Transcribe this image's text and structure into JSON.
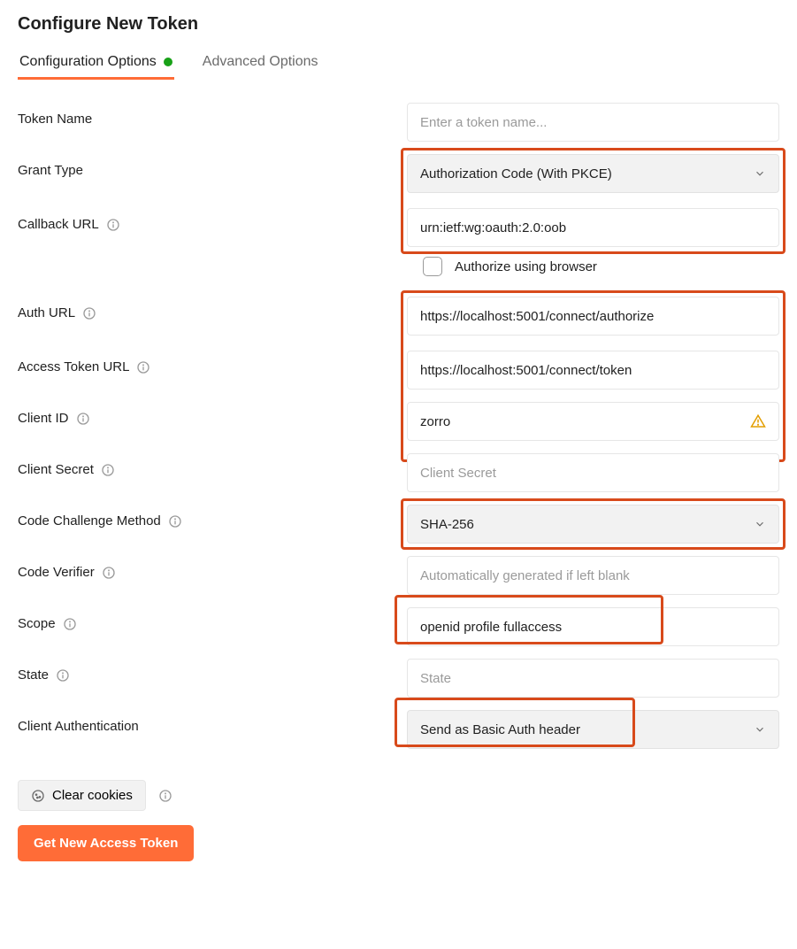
{
  "title": "Configure New Token",
  "tabs": {
    "config": "Configuration Options",
    "advanced": "Advanced Options"
  },
  "fields": {
    "tokenName": {
      "label": "Token Name",
      "placeholder": "Enter a token name..."
    },
    "grantType": {
      "label": "Grant Type",
      "value": "Authorization Code (With PKCE)"
    },
    "callbackUrl": {
      "label": "Callback URL",
      "value": "urn:ietf:wg:oauth:2.0:oob"
    },
    "authorizeBrowser": {
      "label": "Authorize using browser",
      "checked": false
    },
    "authUrl": {
      "label": "Auth URL",
      "value": "https://localhost:5001/connect/authorize"
    },
    "accessTokenUrl": {
      "label": "Access Token URL",
      "value": "https://localhost:5001/connect/token"
    },
    "clientId": {
      "label": "Client ID",
      "value": "zorro"
    },
    "clientSecret": {
      "label": "Client Secret",
      "placeholder": "Client Secret"
    },
    "codeChallenge": {
      "label": "Code Challenge Method",
      "value": "SHA-256"
    },
    "codeVerifier": {
      "label": "Code Verifier",
      "placeholder": "Automatically generated if left blank"
    },
    "scope": {
      "label": "Scope",
      "value": "openid profile fullaccess"
    },
    "state": {
      "label": "State",
      "placeholder": "State"
    },
    "clientAuth": {
      "label": "Client Authentication",
      "value": "Send as Basic Auth header"
    }
  },
  "actions": {
    "clearCookies": "Clear cookies",
    "getToken": "Get New Access Token"
  }
}
